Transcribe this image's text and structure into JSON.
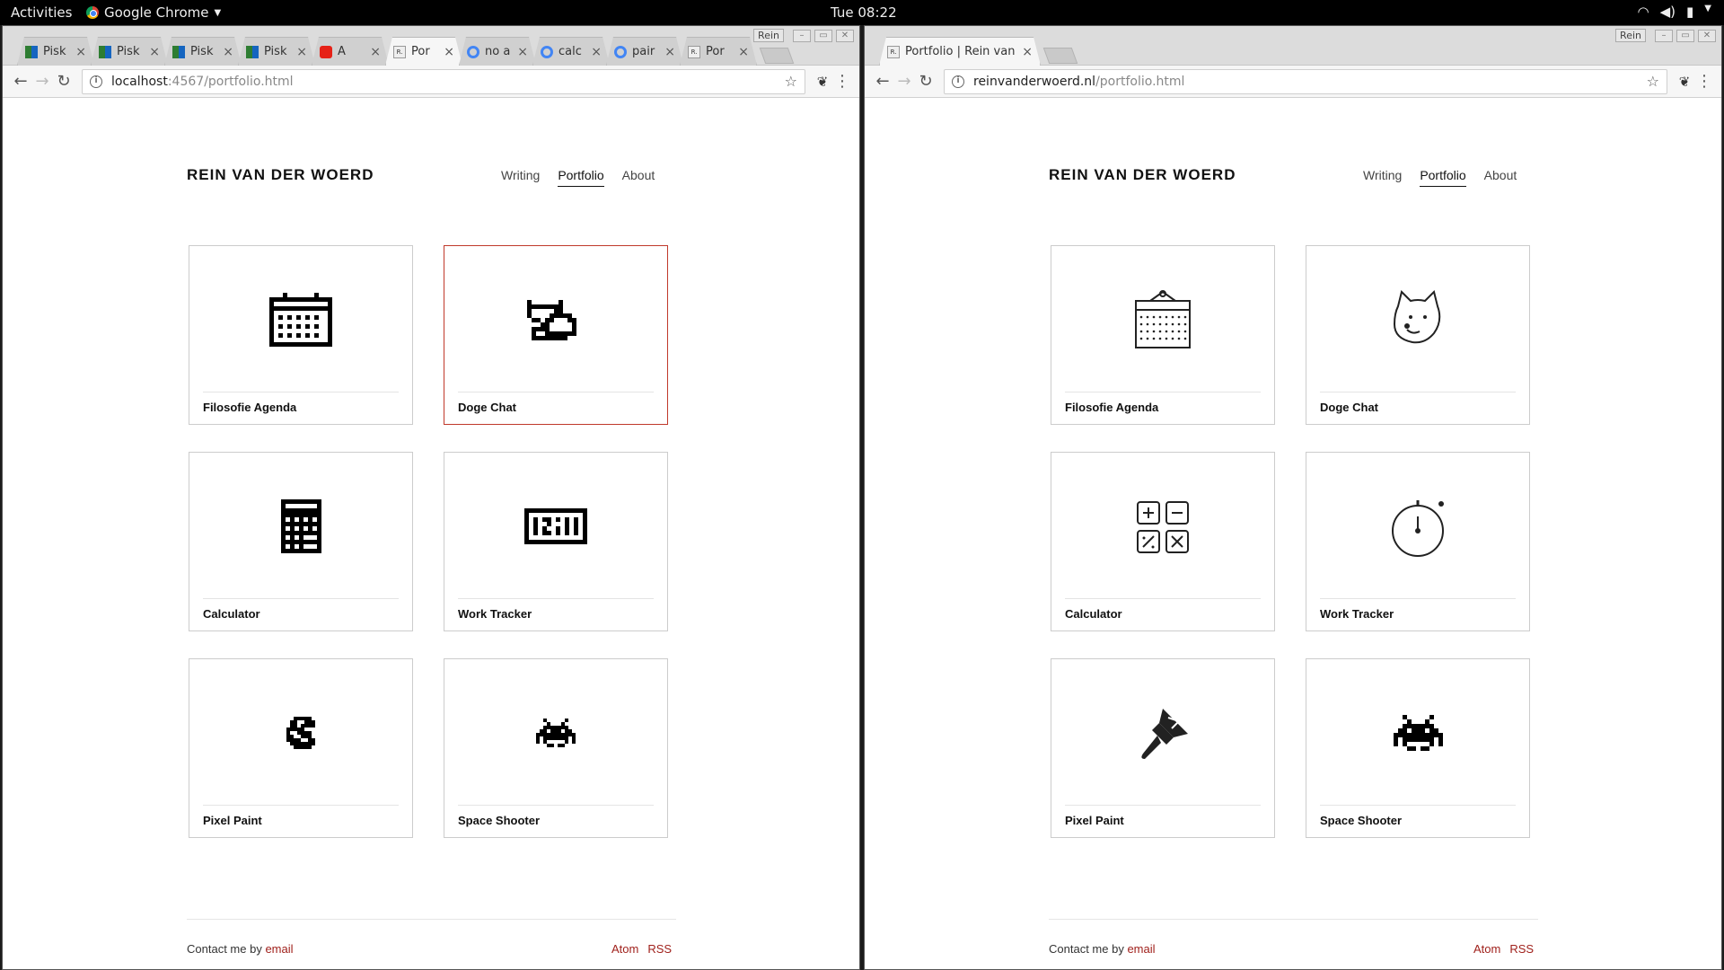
{
  "topbar": {
    "activities": "Activities",
    "app": "Google Chrome",
    "clock": "Tue 08:22",
    "tray_icons": [
      "wifi-icon",
      "volume-icon",
      "battery-icon",
      "power-menu-icon"
    ]
  },
  "left_window": {
    "tabs": [
      {
        "title": "Pisk",
        "favicon": "grid",
        "active": false
      },
      {
        "title": "Pisk",
        "favicon": "grid",
        "active": false
      },
      {
        "title": "Pisk",
        "favicon": "grid",
        "active": false
      },
      {
        "title": "Pisk",
        "favicon": "grid",
        "active": false
      },
      {
        "title": "A",
        "favicon": "youtube",
        "active": false
      },
      {
        "title": "Por",
        "favicon": "r",
        "active": true
      },
      {
        "title": "no a",
        "favicon": "google",
        "active": false
      },
      {
        "title": "calc",
        "favicon": "google",
        "active": false
      },
      {
        "title": "pair",
        "favicon": "google",
        "active": false
      },
      {
        "title": "Por",
        "favicon": "r",
        "active": false
      }
    ],
    "profile": "Rein",
    "url_host": "localhost",
    "url_path": ":4567/portfolio.html",
    "icon_style": "pixel"
  },
  "right_window": {
    "tabs": [
      {
        "title": "Portfolio | Rein van de",
        "favicon": "r",
        "active": true
      }
    ],
    "profile": "Rein",
    "url_host": "reinvanderwoerd.nl",
    "url_path": "/portfolio.html",
    "icon_style": "line"
  },
  "site": {
    "title": "REIN VAN DER WOERD",
    "nav": [
      {
        "label": "Writing",
        "active": false
      },
      {
        "label": "Portfolio",
        "active": true
      },
      {
        "label": "About",
        "active": false
      }
    ],
    "projects": [
      {
        "label": "Filosofie Agenda",
        "icon": "calendar-icon"
      },
      {
        "label": "Doge Chat",
        "icon": "doge-icon"
      },
      {
        "label": "Calculator",
        "icon": "calculator-icon"
      },
      {
        "label": "Work Tracker",
        "icon": "stopwatch-icon"
      },
      {
        "label": "Pixel Paint",
        "icon": "paintbrush-icon"
      },
      {
        "label": "Space Shooter",
        "icon": "space-invader-icon"
      }
    ],
    "footer": {
      "contact_prefix": "Contact me by",
      "contact_link": "email",
      "feeds": [
        "Atom",
        "RSS"
      ]
    }
  },
  "colors": {
    "link": "#a0211c",
    "highlight_border": "#c0392b"
  }
}
